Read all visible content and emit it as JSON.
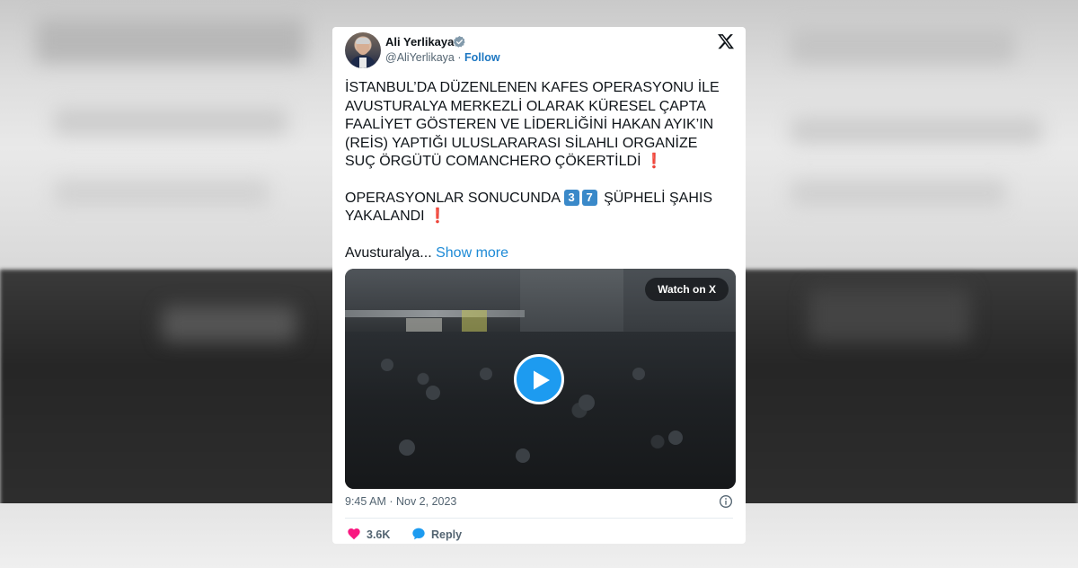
{
  "tweet": {
    "author_name": "Ali Yerlikaya",
    "handle": "@AliYerlikaya",
    "separator": "·",
    "follow_label": "Follow",
    "paragraph1": "İSTANBUL’DA DÜZENLENEN KAFES OPERASYONU İLE AVUSTURALYA MERKEZLİ OLARAK KÜRESEL ÇAPTA FAALİYET GÖSTEREN VE LİDERLİĞİNİ HAKAN AYIK’IN (REİS) YAPTIĞI ULUSLARARASI SİLAHLI ORGANİZE SUÇ ÖRGÜTÜ COMANCHERO ÇÖKERTİLDİ",
    "paragraph2_prefix": "OPERASYONLAR SONUCUNDA",
    "count_digit1": "3",
    "count_digit2": "7",
    "paragraph2_suffix": "ŞÜPHELİ ŞAHIS YAKALANDI",
    "exclamation": "❗",
    "truncated_text": "Avusturalya...",
    "show_more_label": "Show more",
    "watch_label": "Watch on X",
    "timestamp": "9:45 AM · Nov 2, 2023",
    "like_count": "3.6K",
    "reply_label": "Reply"
  },
  "icons": {
    "verified": "verified-badge-icon",
    "platform": "x-logo-icon",
    "play": "play-icon",
    "info": "info-icon",
    "like": "heart-icon",
    "reply": "reply-bubble-icon"
  },
  "colors": {
    "link": "#1d77c2",
    "play_button": "#1d9bf0",
    "heart": "#f91880",
    "exclamation": "#d0211f",
    "keycap": "#3a89c9"
  }
}
